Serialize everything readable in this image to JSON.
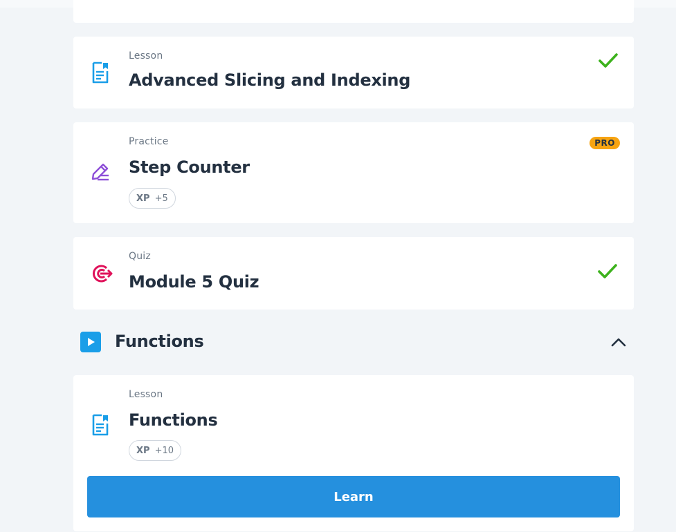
{
  "items": [
    {
      "type": "Lesson",
      "title": "Advanced Slicing and Indexing",
      "icon": "lesson-document-icon",
      "status": "completed"
    },
    {
      "type": "Practice",
      "title": "Step Counter",
      "icon": "practice-pencil-icon",
      "badge": "PRO",
      "xp_label": "XP",
      "xp_value": "+5"
    },
    {
      "type": "Quiz",
      "title": "Module 5 Quiz",
      "icon": "quiz-target-icon",
      "status": "completed"
    }
  ],
  "section": {
    "title": "Functions",
    "icon": "play-icon",
    "toggle_icon": "chevron-up-icon",
    "items": [
      {
        "type": "Lesson",
        "title": "Functions",
        "icon": "lesson-document-icon",
        "xp_label": "XP",
        "xp_value": "+10",
        "button_label": "Learn"
      }
    ]
  },
  "colors": {
    "page_background": "#f2f5f8",
    "lesson_icon": "#1a9ee8",
    "practice_icon": "#8e4fd8",
    "quiz_icon": "#e0125a",
    "check": "#3db21d",
    "pro_badge": "#f7a411",
    "learn_button": "#2590de"
  }
}
